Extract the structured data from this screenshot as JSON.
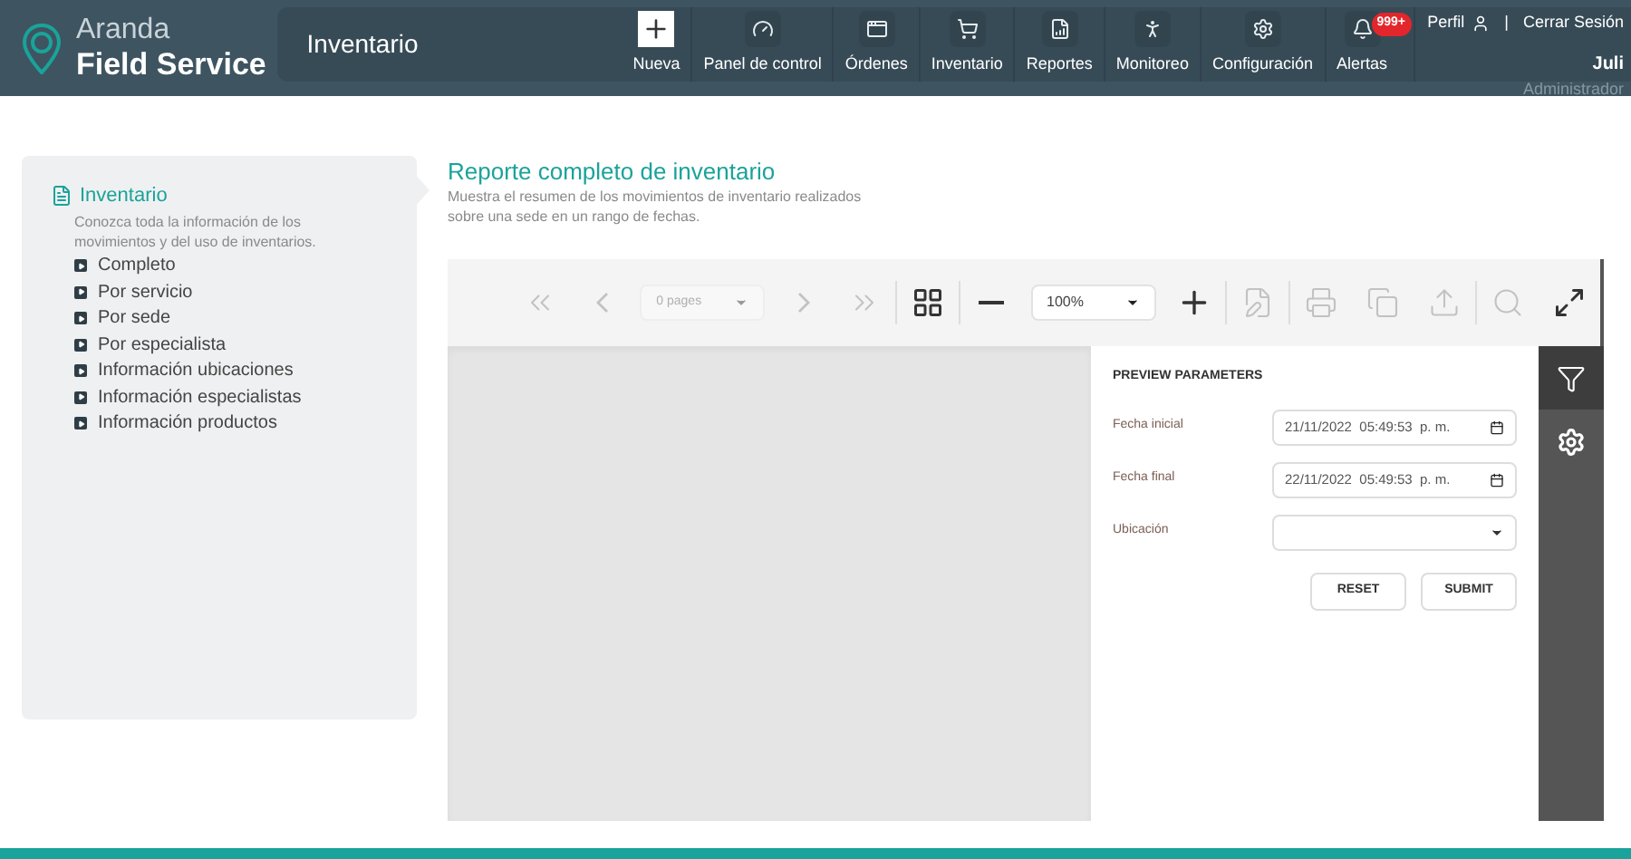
{
  "header": {
    "logo": {
      "line1": "Aranda",
      "line2": "Field Service"
    },
    "section_title": "Inventario",
    "nav": [
      {
        "label": "Nueva",
        "kind": "new"
      },
      {
        "label": "Panel de control",
        "kind": "item"
      },
      {
        "label": "Órdenes",
        "kind": "item"
      },
      {
        "label": "Inventario",
        "kind": "item"
      },
      {
        "label": "Reportes",
        "kind": "item"
      },
      {
        "label": "Monitoreo",
        "kind": "item"
      },
      {
        "label": "Configuración",
        "kind": "item"
      },
      {
        "label": "Alertas",
        "kind": "item",
        "badge": "999+"
      }
    ],
    "user": {
      "profile_link": "Perfil",
      "separator": "|",
      "logout_link": "Cerrar Sesión",
      "name": "Juli",
      "role": "Administrador"
    }
  },
  "sidebar": {
    "title": "Inventario",
    "description": "Conozca toda la información de los movimientos y del uso de inventarios.",
    "items": [
      {
        "label": "Completo"
      },
      {
        "label": "Por servicio"
      },
      {
        "label": "Por sede"
      },
      {
        "label": "Por especialista"
      },
      {
        "label": "Información ubicaciones"
      },
      {
        "label": "Información especialistas"
      },
      {
        "label": "Información productos"
      }
    ]
  },
  "report": {
    "title": "Reporte completo de inventario",
    "description": "Muestra el resumen de los movimientos de inventario realizados sobre una sede en un rango de fechas."
  },
  "viewer": {
    "toolbar": {
      "pages": "0 pages",
      "zoom": "100%",
      "buttons": [
        {
          "disabled": true
        },
        {
          "disabled": true
        },
        {
          "disabled": true
        },
        {
          "disabled": true
        },
        {
          "disabled": false
        },
        {
          "disabled": false
        },
        {
          "disabled": false
        },
        {
          "disabled": true
        },
        {
          "disabled": true
        },
        {
          "disabled": true
        },
        {
          "disabled": true
        },
        {
          "disabled": true
        },
        {
          "disabled": false
        }
      ]
    },
    "parameters": {
      "title": "PREVIEW PARAMETERS",
      "fields": [
        {
          "label": "Fecha inicial",
          "kind": "datetime",
          "value": "21/11/2022  05:49:53  p. m."
        },
        {
          "label": "Fecha final",
          "kind": "datetime",
          "value": "22/11/2022  05:49:53  p. m."
        },
        {
          "label": "Ubicación",
          "kind": "select"
        }
      ],
      "buttons": [
        "RESET",
        "SUBMIT"
      ]
    },
    "side_tabs": [
      {
        "selected": true
      },
      {
        "selected": false
      }
    ]
  }
}
